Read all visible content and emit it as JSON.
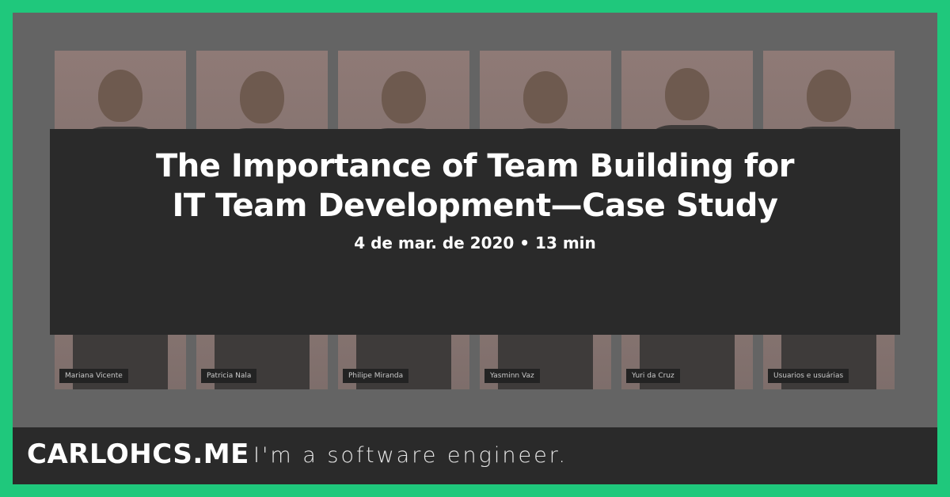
{
  "colors": {
    "accent_border": "#1fc87c",
    "overlay_box": "#2a2a2a",
    "footer": "#2a2a2a",
    "text": "#ffffff"
  },
  "post": {
    "title_line1": "The Importance of Team Building for",
    "title_line2": "IT Team Development—Case Study",
    "meta": "4 de mar. de 2020 • 13 min"
  },
  "background_cards": [
    {
      "name": "Mariana Vicente"
    },
    {
      "name": "Patricia Nala"
    },
    {
      "name": "Philipe Miranda"
    },
    {
      "name": "Yasminn Vaz"
    },
    {
      "name": "Yuri da Cruz"
    },
    {
      "name": "Usuarios e usuárias"
    }
  ],
  "site": {
    "brand": "CARLOHCS.ME",
    "tagline": "I'm a software engineer."
  }
}
